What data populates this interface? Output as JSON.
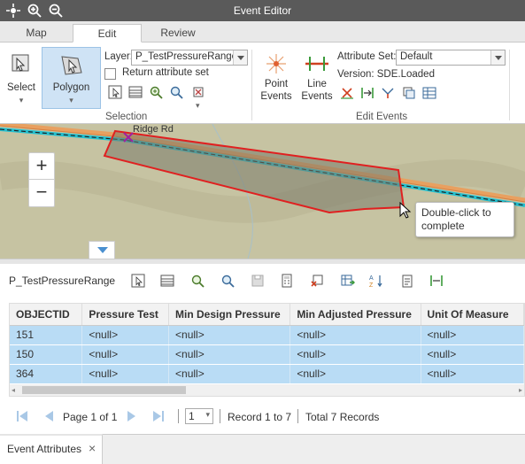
{
  "window": {
    "title": "Event Editor"
  },
  "tabs": [
    {
      "label": "Map"
    },
    {
      "label": "Edit"
    },
    {
      "label": "Review"
    }
  ],
  "selection_group": {
    "label": "Selection",
    "select_label": "Select",
    "polygon_label": "Polygon",
    "layer_label": "Layer:",
    "layer_value": "P_TestPressureRange",
    "return_attr_label": "Return attribute set"
  },
  "edit_events_group": {
    "label": "Edit Events",
    "point_events_label": "Point Events",
    "line_events_label": "Line Events",
    "attribute_set_label": "Attribute Set:",
    "attribute_set_value": "Default",
    "version_label": "Version: SDE.Loaded"
  },
  "map": {
    "zoom_in": "+",
    "zoom_out": "−",
    "tooltip": "Double-click to complete",
    "road_label": "Ridge Rd"
  },
  "table": {
    "layer_name": "P_TestPressureRange",
    "columns": [
      "OBJECTID",
      "Pressure Test",
      "Min Design Pressure",
      "Min Adjusted Pressure",
      "Unit Of Measure"
    ],
    "rows": [
      [
        "151",
        "<null>",
        "<null>",
        "<null>",
        "<null>"
      ],
      [
        "150",
        "<null>",
        "<null>",
        "<null>",
        "<null>"
      ],
      [
        "364",
        "<null>",
        "<null>",
        "<null>",
        "<null>"
      ]
    ]
  },
  "pager": {
    "page_text": "Page 1 of 1",
    "page_select": "1",
    "record_text": "Record 1 to 7",
    "total_text": "Total 7 Records"
  },
  "bottom_tab": {
    "label": "Event Attributes",
    "close": "×"
  },
  "colors": {
    "titlebar": "#5a5a5a",
    "selected_row": "#b9dcf5",
    "accent": "#4a90d0",
    "polygon": "#e02020"
  }
}
